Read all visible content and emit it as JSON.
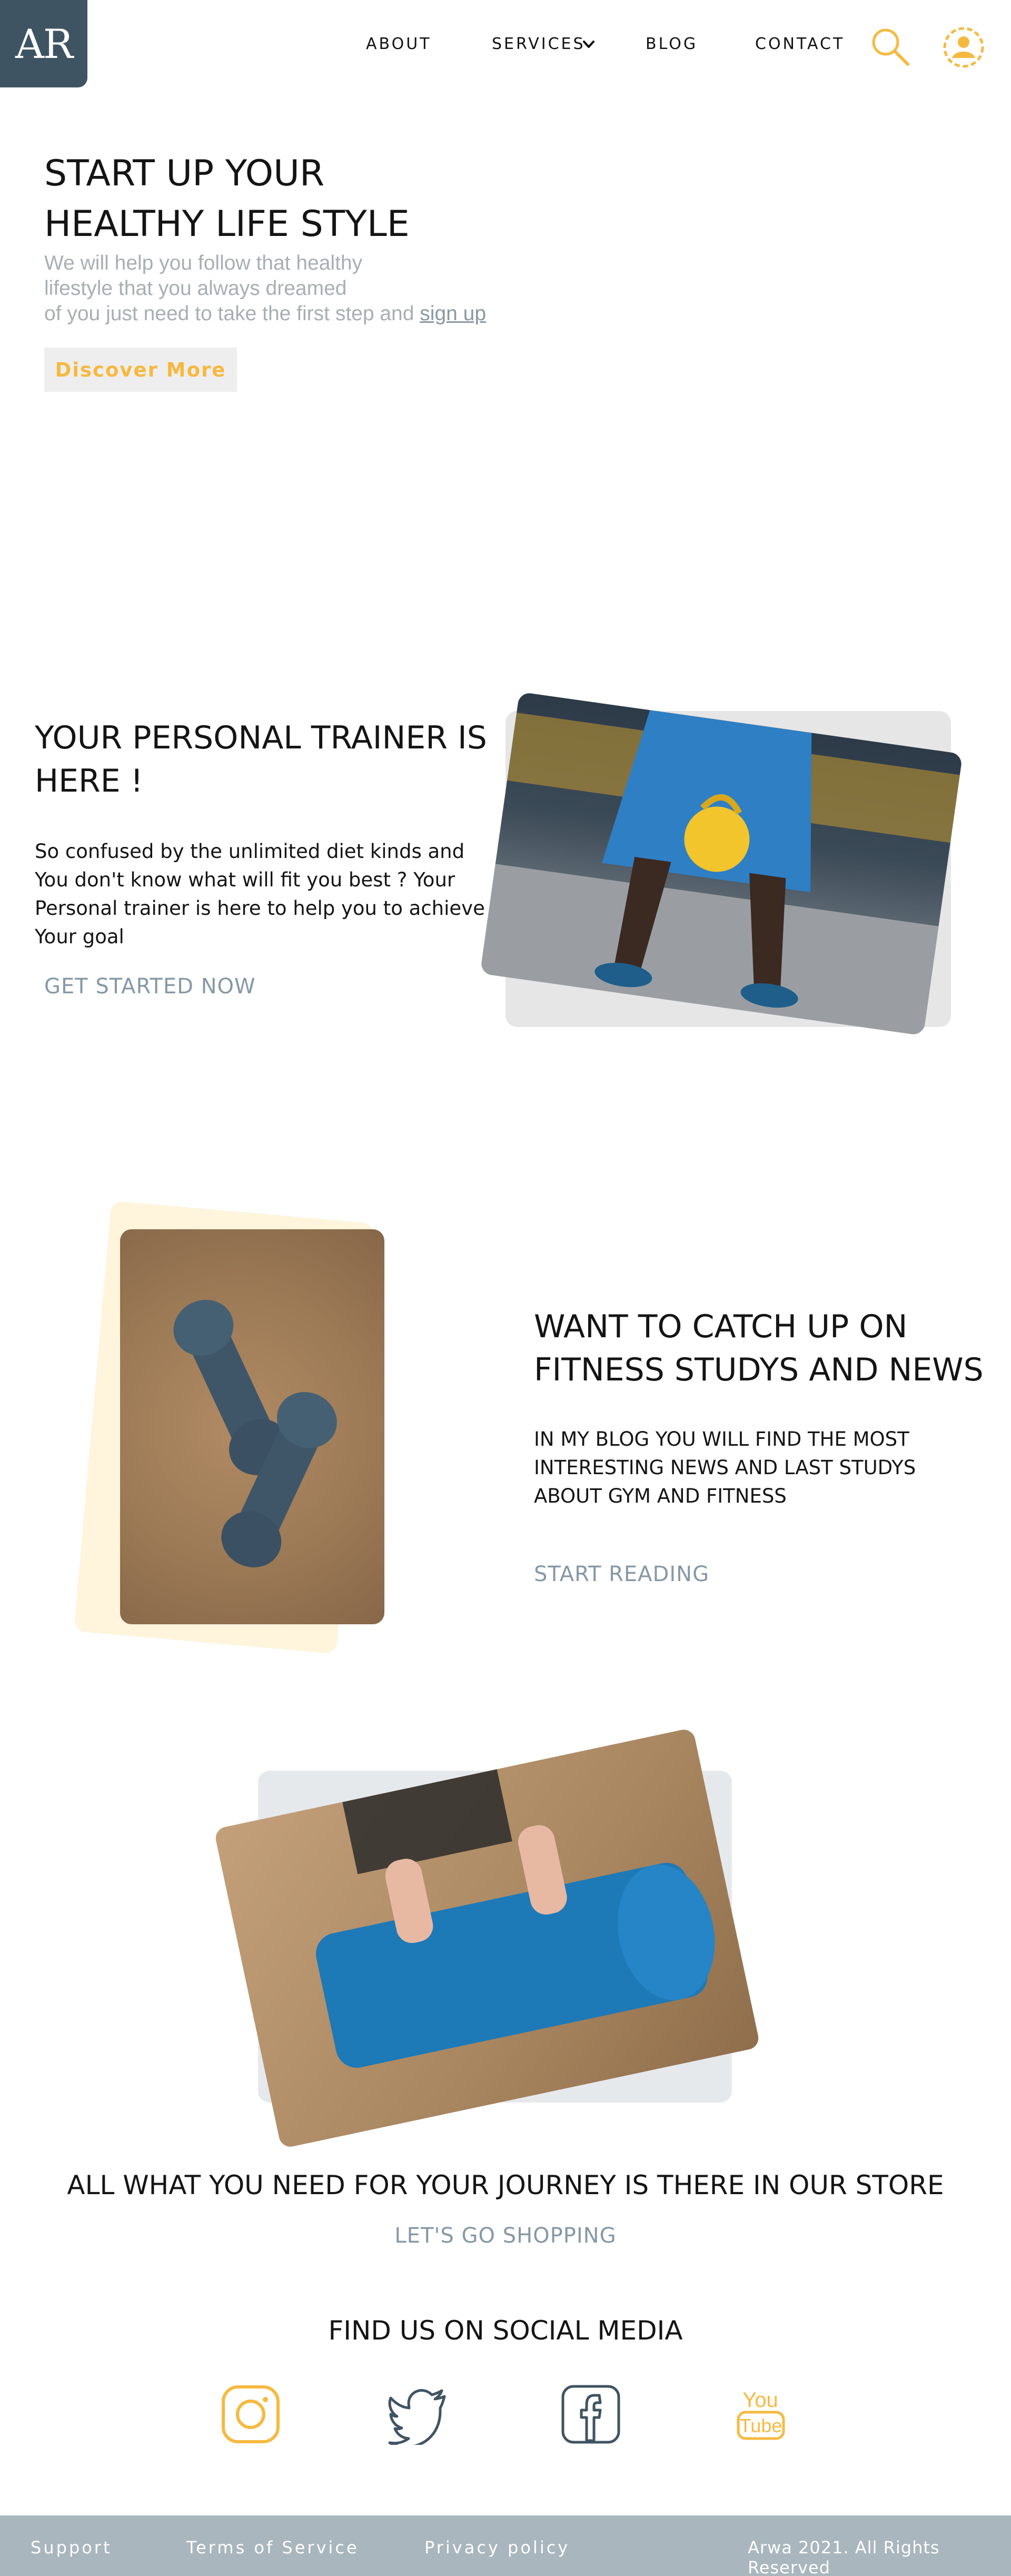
{
  "header": {
    "logo_text": "AR",
    "nav": [
      {
        "label": "ABOUT"
      },
      {
        "label": "SERVICES"
      },
      {
        "label": "BLOG"
      },
      {
        "label": "CONTACT"
      }
    ],
    "icons": [
      "chevron-down-icon",
      "search-icon",
      "user-icon"
    ]
  },
  "hero": {
    "title_line1": "START UP YOUR",
    "title_line2": "HEALTHY LIFE STYLE",
    "text_line1": "We will help you follow that healthy",
    "text_line2": "lifestyle that you always dreamed",
    "text_line3": "of you just need to take the first step and ",
    "signup_link": "sign up",
    "discover_button": "Discover More"
  },
  "trainer": {
    "title_line1": "YOUR PERSONAL TRAINER IS",
    "title_line2": "HERE !",
    "text_line1": "So confused by the unlimited diet kinds and",
    "text_line2": "You don't know what will fit you best ? Your",
    "text_line3": "Personal trainer is here to help you to achieve",
    "text_line4": "Your goal",
    "link": "GET STARTED NOW"
  },
  "blog": {
    "title_line1": "WANT TO CATCH UP ON",
    "title_line2": "FITNESS STUDYS AND NEWS",
    "text_line1": "IN MY BLOG YOU WILL FIND THE MOST",
    "text_line2": "INTERESTING NEWS AND LAST STUDYS",
    "text_line3": "ABOUT GYM AND FITNESS",
    "link": "START READING"
  },
  "store": {
    "title": "ALL WHAT YOU NEED FOR YOUR JOURNEY IS THERE IN OUR STORE",
    "link": "LET'S GO SHOPPING"
  },
  "social": {
    "title": "FIND US ON SOCIAL MEDIA",
    "icons": [
      "instagram-icon",
      "twitter-icon",
      "facebook-icon",
      "youtube-icon"
    ],
    "youtube_you": "You",
    "youtube_tube": "Tube"
  },
  "footer": {
    "support": "Support",
    "terms": "Terms of Service",
    "privacy": "Privacy policy",
    "copyright": "Arwa 2021. All Rights Reserved"
  },
  "colors": {
    "brand_dark": "#3f5463",
    "accent_yellow": "#f6b940",
    "link_gray": "#8698a6",
    "footer_bg": "#a9b6be"
  }
}
